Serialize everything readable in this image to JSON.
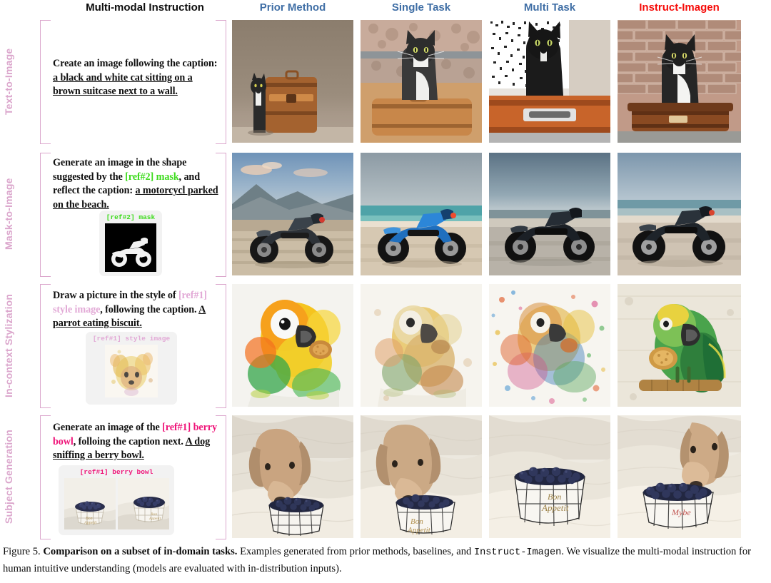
{
  "figure": {
    "caption_prefix": "Figure 5. ",
    "caption_bold": "Comparison on a subset of in-domain tasks.",
    "caption_mid": " Examples generated from prior methods, baselines, and ",
    "caption_mono": "Instruct-Imagen",
    "caption_end": ".",
    "caption_line2": "We visualize the multi-modal instruction for human intuitive understanding (models are evaluated with in-distribution inputs)."
  },
  "columns": [
    {
      "id": "instruction",
      "label": "Multi-modal Instruction",
      "color": "#0d0d0d"
    },
    {
      "id": "prior",
      "label": "Prior Method",
      "color": "#3f6ea5"
    },
    {
      "id": "single",
      "label": "Single Task",
      "color": "#3f6ea5"
    },
    {
      "id": "multi",
      "label": "Multi Task",
      "color": "#3f6ea5"
    },
    {
      "id": "imagen",
      "label": "Instruct-Imagen",
      "color": "#f60b08"
    }
  ],
  "rows": [
    {
      "task": "Text-to-Image",
      "instruction_parts": [
        {
          "text": "Create an image following the caption: ",
          "style": "plain"
        },
        {
          "text": "a black and white cat sitting on a brown suitcase next to a wall.",
          "style": "underline"
        }
      ],
      "reference": null,
      "results": [
        {
          "column": "prior",
          "alt": "black and white cat sitting beside a brown leather suitcase against a tan wall"
        },
        {
          "column": "single",
          "alt": "tuxedo cat sitting on top of a tan suitcase in front of a stone wall"
        },
        {
          "column": "multi",
          "alt": "noisy high-contrast black cat on an orange suitcase"
        },
        {
          "column": "imagen",
          "alt": "black and white cat sitting on a brown leather suitcase against a brick wall"
        }
      ]
    },
    {
      "task": "Mask-to-Image",
      "instruction_parts": [
        {
          "text": "Generate an image in the shape suggested by the ",
          "style": "plain"
        },
        {
          "text": "[ref#2] mask",
          "style": "green"
        },
        {
          "text": ", and reflect the caption: ",
          "style": "plain"
        },
        {
          "text": "a motorcycl parked on the beach.",
          "style": "underline"
        }
      ],
      "reference": {
        "label": "[ref#2] mask",
        "label_color": "#3ddb1c",
        "kind": "mask",
        "alt": "white motorcycle silhouette on black background"
      },
      "results": [
        {
          "column": "prior",
          "alt": "motorcycle parked on sand with mountain and sky"
        },
        {
          "column": "single",
          "alt": "blue motorcycle parked on a beach by turquoise water"
        },
        {
          "column": "multi",
          "alt": "dark motorcycle parked on wet sand at the shore"
        },
        {
          "column": "imagen",
          "alt": "black motorcycle parked on the beach near the waterline"
        }
      ]
    },
    {
      "task": "In-context Stylization",
      "instruction_parts": [
        {
          "text": "Draw a picture in the style of ",
          "style": "plain"
        },
        {
          "text": "[ref#1] style image",
          "style": "mauve"
        },
        {
          "text": ", following the caption. ",
          "style": "plain"
        },
        {
          "text": "A parrot eating biscuit.",
          "style": "underline"
        }
      ],
      "reference": {
        "label": "[ref#1] style image",
        "label_color": "#e2a9d6",
        "kind": "style",
        "alt": "watercolor splash painting of a dog"
      },
      "results": [
        {
          "column": "prior",
          "alt": "bright yellow and green parrot holding a biscuit, watercolor"
        },
        {
          "column": "single",
          "alt": "soft watercolor parrot perched, muted tones"
        },
        {
          "column": "multi",
          "alt": "colorful abstract watercolor splatter of a parrot"
        },
        {
          "column": "imagen",
          "alt": "green and yellow parrot holding a cookie, watercolor on textured paper"
        }
      ]
    },
    {
      "task": "Subject Generation",
      "instruction_parts": [
        {
          "text": "Generate an image of the ",
          "style": "plain"
        },
        {
          "text": "[ref#1] berry bowl",
          "style": "magenta"
        },
        {
          "text": ", folloing the caption next. ",
          "style": "plain"
        },
        {
          "text": "A dog sniffing a berry bowl.",
          "style": "underline"
        }
      ],
      "reference": {
        "label": "[ref#1]  berry bowl",
        "label_color": "#ef1479",
        "kind": "bowl-pair",
        "alt": "two photos of a white wire bowl filled with blueberries on white fabric"
      },
      "results": [
        {
          "column": "prior",
          "alt": "tan dog sniffing a wire bowl of blueberries on white fabric"
        },
        {
          "column": "single",
          "alt": "dog leaning over bowl of blueberries labeled Bon Appetit"
        },
        {
          "column": "multi",
          "alt": "bowl of blueberries with Bon Appetit text on white fabric"
        },
        {
          "column": "imagen",
          "alt": "dog sniffing a bowl of blueberries on white bedding"
        }
      ]
    }
  ],
  "colors": {
    "header_blue": "#3f6ea5",
    "header_red": "#f60b08",
    "task_label_pink": "#dba6cc",
    "ref_green": "#3ddb1c",
    "ref_mauve": "#e2a9d6",
    "ref_magenta": "#ef1479"
  }
}
